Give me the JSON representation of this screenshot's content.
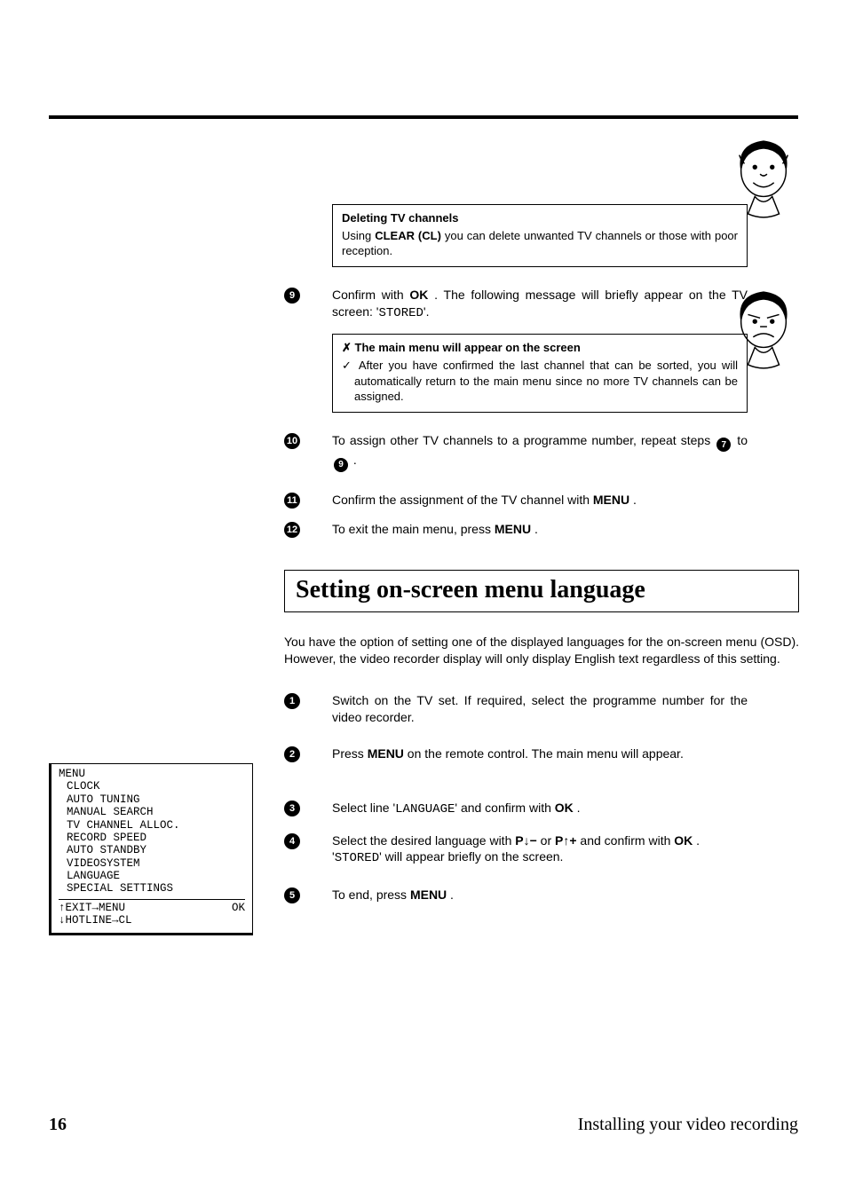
{
  "tip1": {
    "title": "Deleting TV channels",
    "body_pre": "Using ",
    "body_bold": "CLEAR (CL)",
    "body_post": " you can delete unwanted TV channels or those with poor reception."
  },
  "step9": {
    "n": "9",
    "pre": "Confirm with ",
    "btn": "OK",
    "post1": " . The following message will briefly appear on the TV screen: '",
    "mono": "STORED",
    "post2": "'."
  },
  "check": {
    "title": "The main menu will appear on the screen",
    "body": "After you have confirmed the last channel that can be sorted, you will automatically return to the main menu since no more TV channels can be assigned."
  },
  "step10": {
    "n": "10",
    "pre": "To assign other TV channels to a programme number, repeat steps ",
    "r1": "7",
    "mid": " to ",
    "r2": "9",
    "post": " ."
  },
  "step11": {
    "n": "11",
    "pre": "Confirm the assignment of the TV channel with ",
    "btn": "MENU",
    "post": " ."
  },
  "step12": {
    "n": "12",
    "pre": "To exit the main menu, press ",
    "btn": "MENU",
    "post": " ."
  },
  "section_title": "Setting on-screen menu language",
  "intro": "You have the option of setting one of the displayed languages for the on-screen menu (OSD). However, the video recorder display will only display English text regardless of this setting.",
  "s1": {
    "n": "1",
    "text": "Switch on the TV set. If required, select the programme number for the video recorder."
  },
  "s2": {
    "n": "2",
    "pre": "Press ",
    "btn": "MENU",
    "post": " on the remote control. The main menu will appear."
  },
  "s3": {
    "n": "3",
    "pre": "Select line '",
    "mono": "LANGUAGE",
    "mid": "' and confirm with ",
    "btn": "OK",
    "post": " ."
  },
  "s4": {
    "n": "4",
    "pre": "Select the desired language with ",
    "k1": "P",
    "mid1": " or ",
    "k2": "P",
    "mid2": " and confirm with  ",
    "btn": "OK",
    "post1": " .",
    "line2a": "'",
    "mono": "STORED",
    "line2b": "' will appear briefly on the screen."
  },
  "s5": {
    "n": "5",
    "pre": "To end, press ",
    "btn": "MENU",
    "post": " ."
  },
  "osd": {
    "title": "MENU",
    "items": [
      "CLOCK",
      "AUTO TUNING",
      "MANUAL SEARCH",
      "TV CHANNEL ALLOC.",
      "RECORD SPEED",
      "AUTO STANDBY",
      "VIDEOSYSTEM",
      "LANGUAGE",
      "SPECIAL SETTINGS"
    ],
    "exit": "↑EXIT→MENU",
    "ok": "OK",
    "hotline": "↓HOTLINE→CL"
  },
  "page_num": "16",
  "footer": "Installing your video recording"
}
